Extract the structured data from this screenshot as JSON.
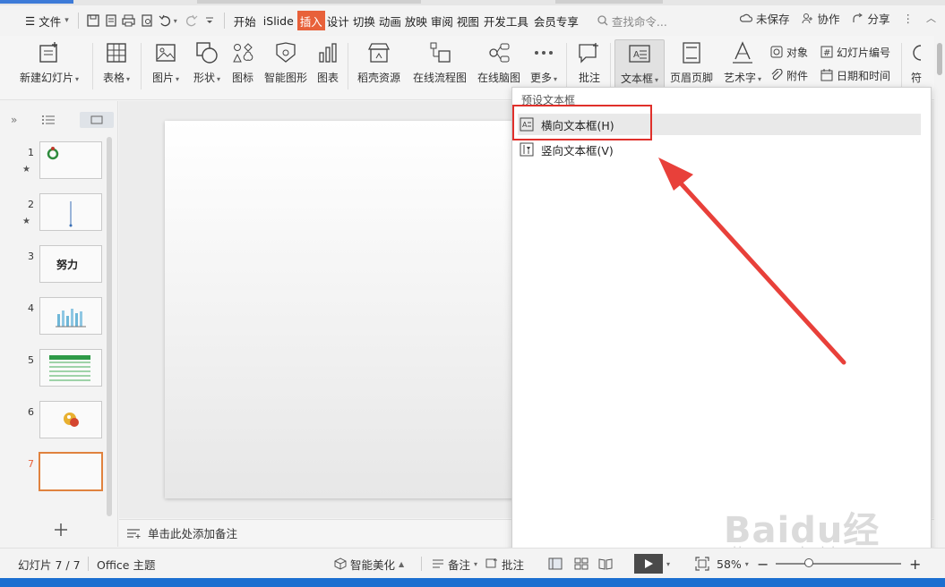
{
  "menubar": {
    "file_label": "文件",
    "tabs": [
      "开始",
      "iSlide",
      "插入",
      "设计",
      "切换",
      "动画",
      "放映",
      "审阅",
      "视图",
      "开发工具",
      "会员专享"
    ],
    "active_tab": "插入",
    "search_placeholder": "查找命令...",
    "unsaved_label": "未保存",
    "collab_label": "协作",
    "share_label": "分享"
  },
  "ribbon": {
    "new_slide": "新建幻灯片",
    "table": "表格",
    "picture": "图片",
    "shape": "形状",
    "icon": "图标",
    "smartart": "智能图形",
    "chart": "图表",
    "docer": "稻壳资源",
    "flowchart": "在线流程图",
    "mindmap": "在线脑图",
    "more": "更多",
    "comment": "批注",
    "textbox": "文本框",
    "header_footer": "页眉页脚",
    "wordart": "艺术字",
    "object": "对象",
    "attachment": "附件",
    "slide_number": "幻灯片编号",
    "datetime": "日期和时间",
    "symbol": "符"
  },
  "slides": [
    {
      "num": "1",
      "star": "★"
    },
    {
      "num": "2",
      "star": "★"
    },
    {
      "num": "3",
      "text": "努力"
    },
    {
      "num": "4"
    },
    {
      "num": "5"
    },
    {
      "num": "6"
    },
    {
      "num": "7"
    }
  ],
  "current_slide": "7",
  "notes_placeholder": "单击此处添加备注",
  "dropdown": {
    "header": "预设文本框",
    "items": [
      "横向文本框(H)",
      "竖向文本框(V)"
    ]
  },
  "statusbar": {
    "slide_counter": "幻灯片 7 / 7",
    "theme": "Office 主题",
    "beautify": "智能美化",
    "notes": "备注",
    "comments": "批注",
    "zoom": "58%"
  },
  "watermark": {
    "brand": "Baidu经验",
    "url": "jingyan.baidu.com"
  },
  "colors": {
    "active_tab": "#e8613a",
    "highlight_box": "#e0302b",
    "arrow": "#e8403a",
    "current_slide": "#e0823e"
  }
}
